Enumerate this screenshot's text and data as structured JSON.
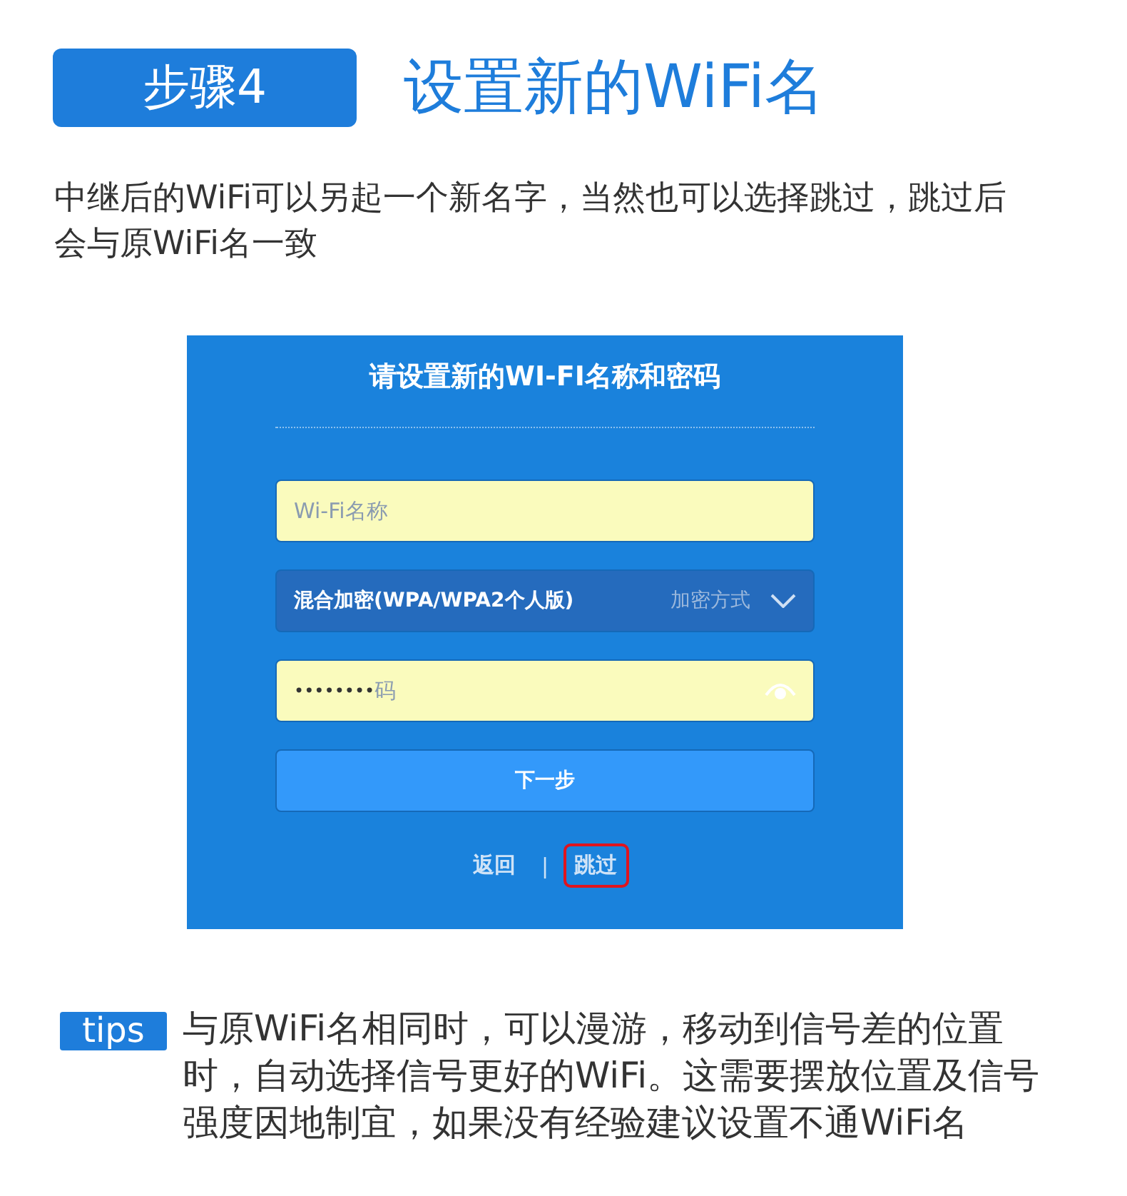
{
  "header": {
    "step_badge": "步骤4",
    "title": "设置新的WiFi名"
  },
  "intro": "中继后的WiFi可以另起一个新名字，当然也可以选择跳过，跳过后会与原WiFi名一致",
  "panel": {
    "title": "请设置新的WI-FI名称和密码",
    "name_field": {
      "placeholder": "Wi-Fi名称"
    },
    "encryption_select": {
      "value": "混合加密(WPA/WPA2个人版)",
      "label": "加密方式"
    },
    "password_field": {
      "value": "••••••••",
      "placeholder_remnant": "码"
    },
    "next_button": "下一步",
    "links": [
      {
        "label": "返回",
        "highlighted": false
      },
      {
        "label": "跳过",
        "highlighted": true
      }
    ],
    "separator": "|"
  },
  "tips": {
    "badge": "tips",
    "text": "与原WiFi名相同时，可以漫游，移动到信号差的位置时，自动选择信号更好的WiFi。这需要摆放位置及信号强度因地制宜，如果没有经验建议设置不通WiFi名"
  }
}
